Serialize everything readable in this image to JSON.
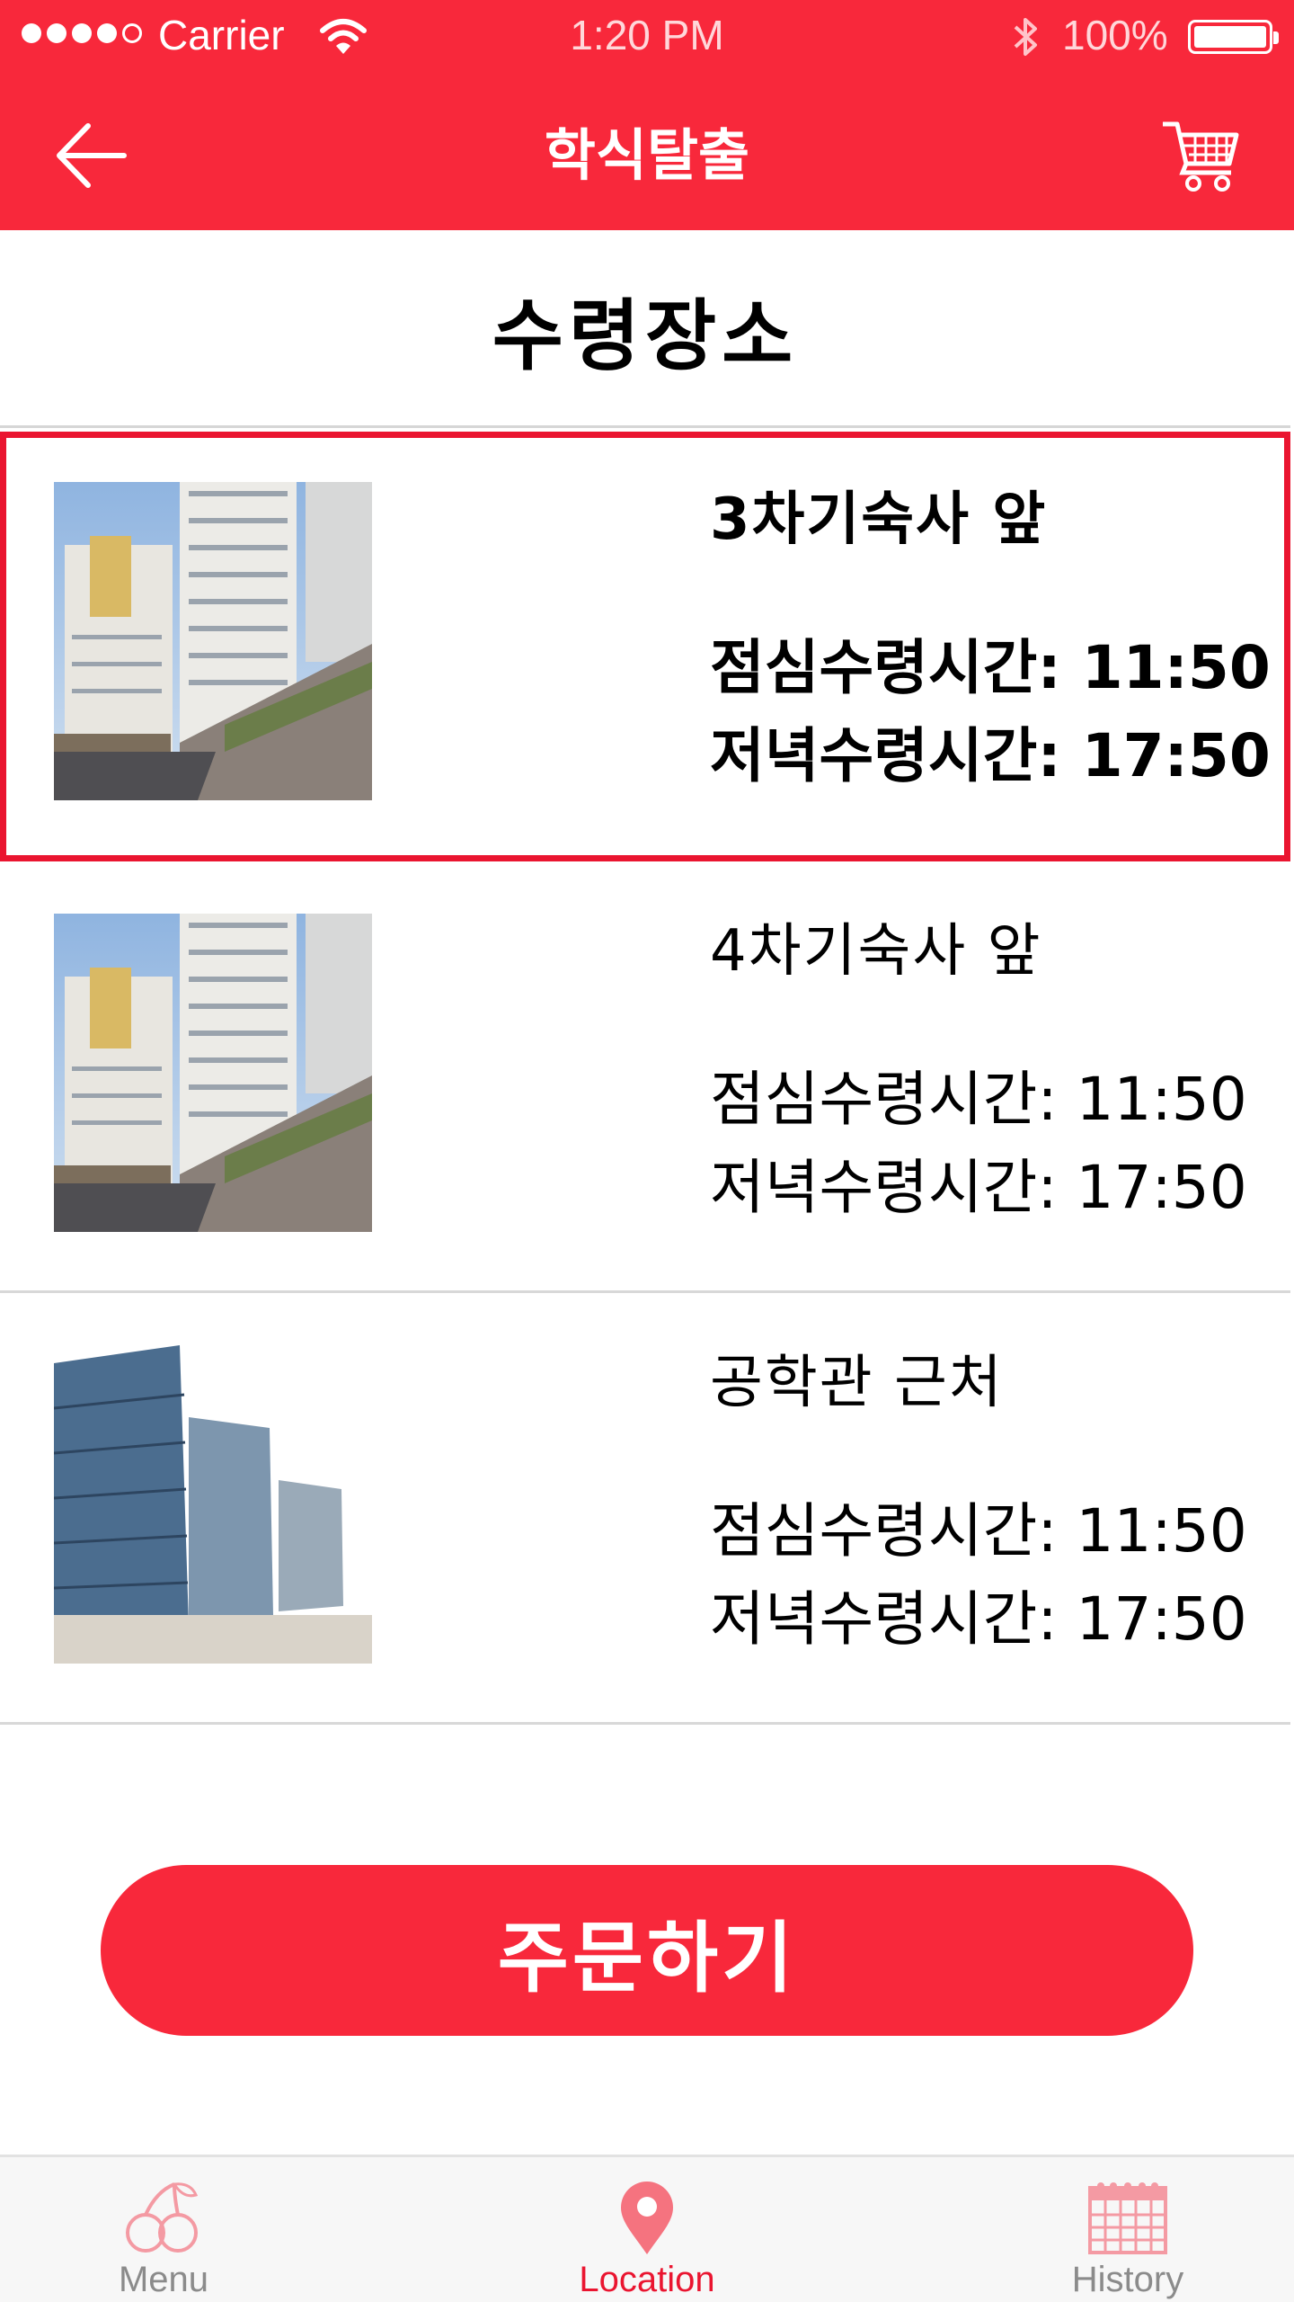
{
  "status_bar": {
    "carrier": "Carrier",
    "time": "1:20 PM",
    "battery": "100%"
  },
  "header": {
    "title": "학식탈출",
    "back_icon": "arrow-left-icon",
    "cart_icon": "cart-icon"
  },
  "section": {
    "title": "수령장소"
  },
  "locations": [
    {
      "name": "3차기숙사  앞",
      "lunch": "점심수령시간: 11:50",
      "dinner": "저녁수령시간: 17:50",
      "selected": true
    },
    {
      "name": "4차기숙사 앞",
      "lunch": "점심수령시간: 11:50",
      "dinner": "저녁수령시간: 17:50",
      "selected": false
    },
    {
      "name": "공학관 근처",
      "lunch": "점심수령시간: 11:50",
      "dinner": "저녁수령시간: 17:50",
      "selected": false
    }
  ],
  "order_button": {
    "label": "주문하기"
  },
  "tabbar": {
    "items": [
      {
        "label": "Menu",
        "icon": "cherry-icon",
        "active": false
      },
      {
        "label": "Location",
        "icon": "map-pin-icon",
        "active": true
      },
      {
        "label": "History",
        "icon": "calendar-icon",
        "active": false
      }
    ]
  },
  "colors": {
    "accent": "#f8283b",
    "selected_border": "#ea1530",
    "inactive_tab": "#8b8b8b"
  }
}
